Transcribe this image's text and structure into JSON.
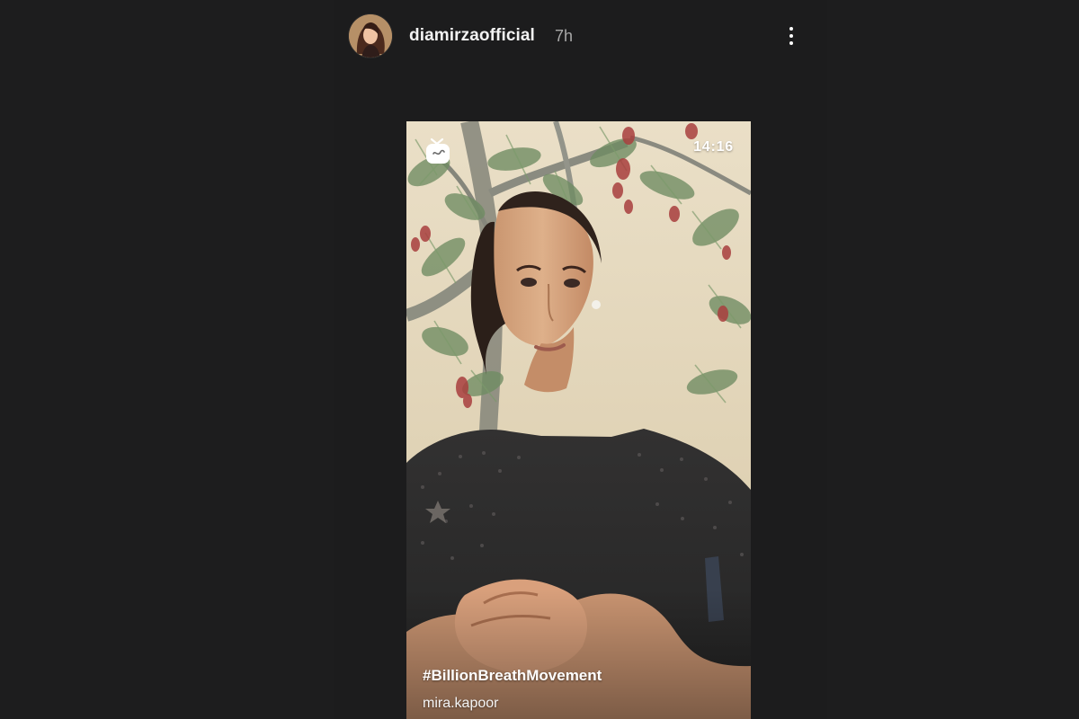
{
  "story": {
    "username": "diamirzaofficial",
    "time_ago": "7h"
  },
  "media": {
    "duration": "14:16",
    "hashtag": "#BillionBreathMovement",
    "author": "mira.kapoor"
  },
  "icons": {
    "more": "more-vertical-icon",
    "igtv": "igtv-icon"
  },
  "colors": {
    "background": "#1d1d1e",
    "username": "#f2f2f2",
    "timestamp": "#a8a8a8"
  }
}
